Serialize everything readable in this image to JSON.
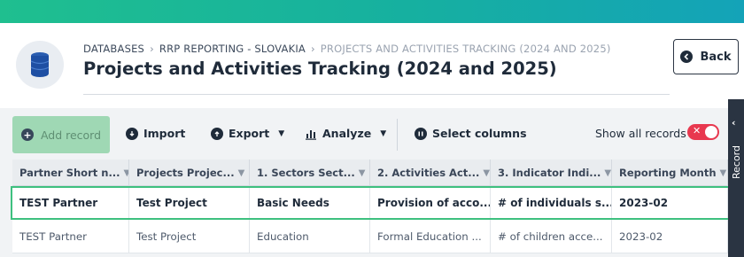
{
  "breadcrumb": {
    "items": [
      "DATABASES",
      "RRP REPORTING - SLOVAKIA",
      "PROJECTS AND ACTIVITIES TRACKING (2024 AND 2025)"
    ],
    "separator": "›"
  },
  "page": {
    "title": "Projects and Activities Tracking (2024 and 2025)"
  },
  "header": {
    "back_label": "Back"
  },
  "toolbar": {
    "add_record": "Add record",
    "import": "Import",
    "export": "Export",
    "analyze": "Analyze",
    "select_columns": "Select columns",
    "show_all_records": "Show all records",
    "show_all_enabled": false
  },
  "side_panel": {
    "label": "Record"
  },
  "table": {
    "columns": [
      "Partner Short n...",
      "Projects Projec...",
      "1. Sectors Sect...",
      "2. Activities Act...",
      "3. Indicator Indi...",
      "Reporting Month"
    ],
    "rows": [
      [
        "TEST Partner",
        "Test Project",
        "Basic Needs",
        "Provision of acco...",
        "# of individuals s...",
        "2023-02"
      ],
      [
        "TEST Partner",
        "Test Project",
        "Education",
        "Formal Education ...",
        "# of children acce...",
        "2023-02"
      ]
    ],
    "selected_row_index": 0
  },
  "colors": {
    "accent_green": "#3ec07f",
    "add_button_bg": "#9fd8b4",
    "toggle_off": "#e8384f",
    "dark": "#1f2b3a"
  },
  "icons": {
    "database": "database-icon",
    "back": "arrow-left-circle-icon",
    "add": "plus-circle-icon",
    "import": "import-icon",
    "export": "export-icon",
    "analyze": "bar-chart-icon",
    "select_columns": "columns-icon",
    "filter": "filter-icon"
  }
}
